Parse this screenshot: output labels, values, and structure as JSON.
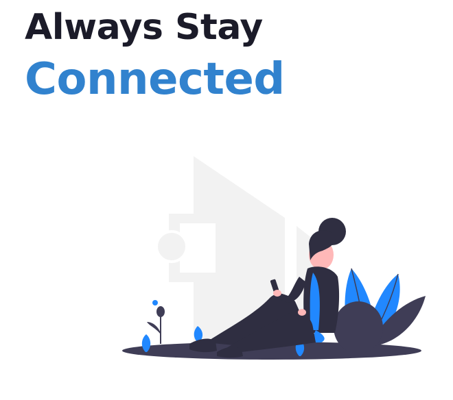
{
  "hero": {
    "headline_line1": "Always Stay",
    "headline_line2": "Connected"
  },
  "colors": {
    "heading_dark": "#1b1b29",
    "accent_blue": "#3182ce",
    "illustration_blue": "#2188ff",
    "illustration_dark": "#3f3d56",
    "background_shape": "#f2f2f2"
  },
  "illustration": {
    "name": "woman-sitting-with-phone-illustration"
  }
}
